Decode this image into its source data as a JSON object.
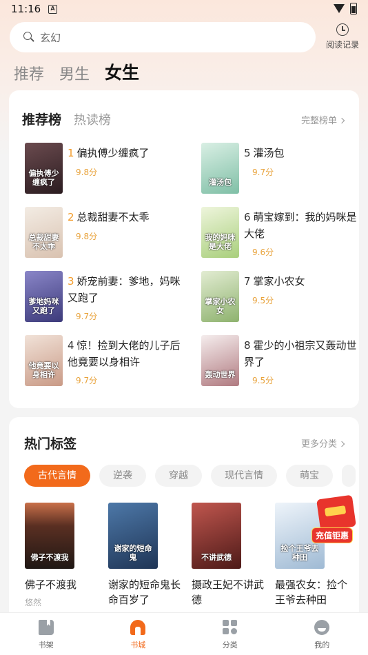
{
  "status_bar": {
    "time": "11:16",
    "notif_letter": "A"
  },
  "search": {
    "placeholder": "玄幻",
    "icon": "search-icon"
  },
  "history": {
    "label": "阅读记录",
    "icon": "clock-icon"
  },
  "gender_tabs": [
    {
      "label": "推荐",
      "active": false
    },
    {
      "label": "男生",
      "active": false
    },
    {
      "label": "女生",
      "active": true
    }
  ],
  "rank_card": {
    "tabs": [
      {
        "label": "推荐榜",
        "active": true
      },
      {
        "label": "热读榜",
        "active": false
      }
    ],
    "more_label": "完整榜单",
    "items": [
      {
        "rank": "1",
        "title": "偏执傅少缠疯了",
        "score": "9.8分",
        "cover_text": "偏执傅少缠疯了",
        "cover_color": "#3b2a2e"
      },
      {
        "rank": "2",
        "title": "总裁甜妻不太乖",
        "score": "9.8分",
        "cover_text": "总裁甜妻不太乖",
        "cover_color": "#e9dfd5"
      },
      {
        "rank": "3",
        "title": "娇宠前妻：爹地，妈咪又跑了",
        "score": "9.7分",
        "cover_text": "爹地妈咪又跑了",
        "cover_color": "#5b5a9e"
      },
      {
        "rank": "4",
        "title": "惊！捡到大佬的儿子后他竟要以身相许",
        "score": "9.7分",
        "cover_text": "他竟要以身相许",
        "cover_color": "#e6cfc2"
      },
      {
        "rank": "5",
        "title": "灌汤包",
        "score": "9.7分",
        "cover_text": "灌汤包",
        "cover_color": "#a9d6c5"
      },
      {
        "rank": "6",
        "title": "萌宝嫁到：我的妈咪是大佬",
        "score": "9.6分",
        "cover_text": "我的妈咪是大佬",
        "cover_color": "#cfe3b2"
      },
      {
        "rank": "7",
        "title": "掌家小农女",
        "score": "9.5分",
        "cover_text": "掌家小农女",
        "cover_color": "#bcd3a4"
      },
      {
        "rank": "8",
        "title": "霍少的小祖宗又轰动世界了",
        "score": "9.5分",
        "cover_text": "轰动世界",
        "cover_color": "#e8dede"
      }
    ]
  },
  "tags_card": {
    "title": "热门标签",
    "more_label": "更多分类",
    "tags": [
      {
        "label": "古代言情",
        "active": true
      },
      {
        "label": "逆袭",
        "active": false
      },
      {
        "label": "穿越",
        "active": false
      },
      {
        "label": "现代言情",
        "active": false
      },
      {
        "label": "萌宝",
        "active": false
      }
    ],
    "books": [
      {
        "title": "佛子不渡我",
        "sub": "悠然",
        "cover_color": "#3a2b24",
        "cover_text": "佛子不渡我"
      },
      {
        "title": "谢家的短命鬼长命百岁了",
        "sub": "",
        "cover_color": "#2d4f7e",
        "cover_text": "谢家的短命鬼"
      },
      {
        "title": "摄政王妃不讲武德",
        "sub": "",
        "cover_color": "#8e2d2a",
        "cover_text": "不讲武德"
      },
      {
        "title": "最强农女：捡个王爷去种田",
        "sub": "",
        "cover_color": "#cfe0ee",
        "cover_text": "捡个王爷去种田"
      }
    ]
  },
  "float_promo": {
    "label": "充值钜惠"
  },
  "bottom_nav": [
    {
      "label": "书架",
      "active": false,
      "icon": "bookshelf-icon"
    },
    {
      "label": "书城",
      "active": true,
      "icon": "bookstore-icon"
    },
    {
      "label": "分类",
      "active": false,
      "icon": "category-icon"
    },
    {
      "label": "我的",
      "active": false,
      "icon": "profile-icon"
    }
  ],
  "colors": {
    "accent": "#f26a1b",
    "score": "#e8a23a",
    "rank_top": "#f39c2b"
  }
}
